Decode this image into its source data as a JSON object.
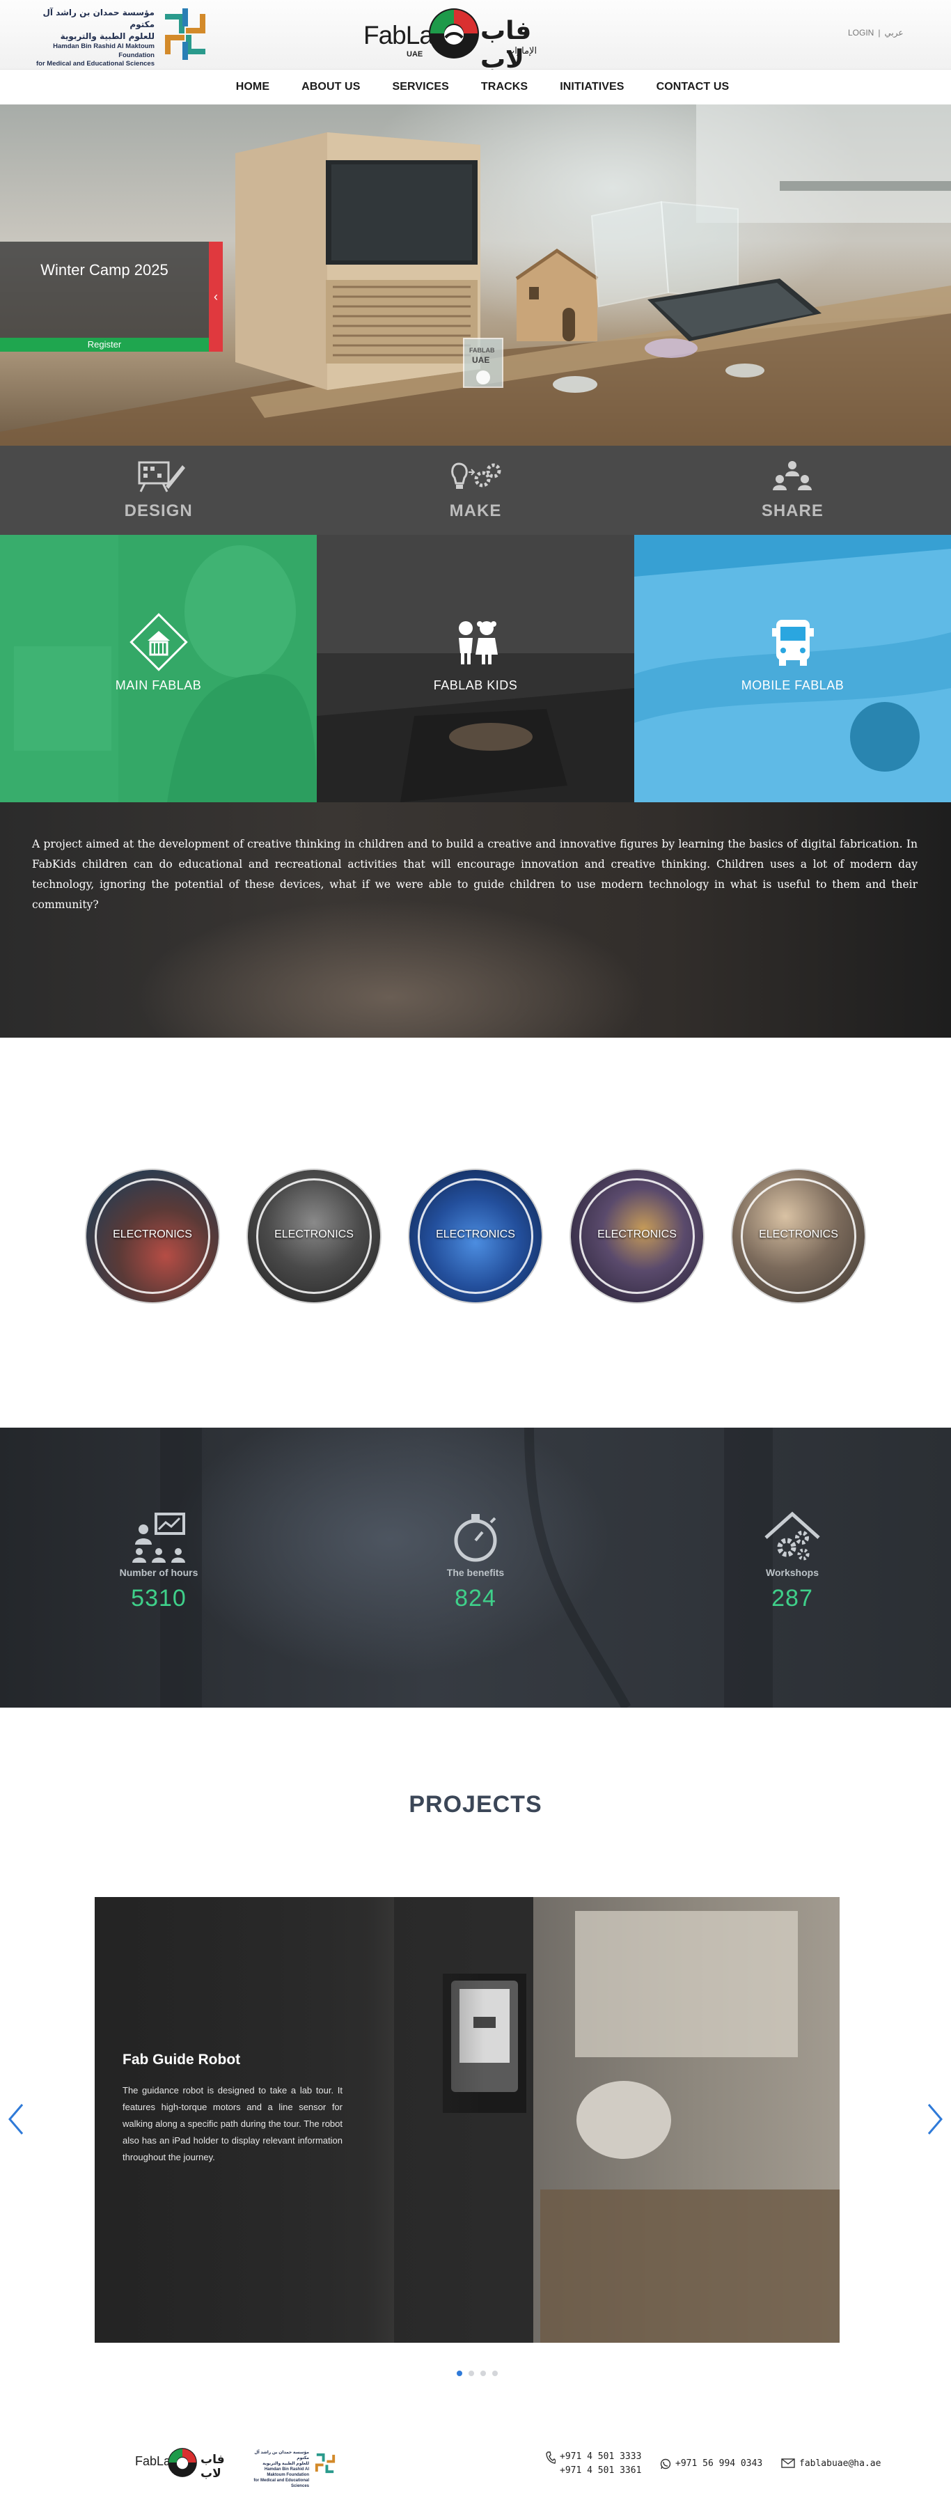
{
  "header": {
    "foundation_ar_line1": "مؤسسة حمدان بن راشد آل مكتوم",
    "foundation_ar_line2": "للعلوم الطبية والتربوية",
    "foundation_en_line1": "Hamdan Bin Rashid Al Maktoum Foundation",
    "foundation_en_line2": "for Medical and Educational Sciences",
    "fablab_en": "FabLab",
    "fablab_uae": "UAE",
    "fablab_ar": "فاب لاب",
    "fablab_ar_sub": "الإمارات",
    "login_label": "LOGIN",
    "separator": "|",
    "arabic_label": "عربي"
  },
  "nav": {
    "items": [
      "HOME",
      "ABOUT US",
      "SERVICES",
      "TRACKS",
      "INITIATIVES",
      "CONTACT US"
    ]
  },
  "hero": {
    "slide_title": "Winter Camp 2025",
    "register_label": "Register",
    "toggle_glyph": "‹",
    "sign_line1": "FABLAB",
    "sign_line2": "UAE"
  },
  "steps": [
    "DESIGN",
    "MAKE",
    "SHARE"
  ],
  "tiles": [
    "MAIN FABLAB",
    "FABLAB KIDS",
    "MOBILE FABLAB"
  ],
  "about": {
    "text": "A project aimed at the development of creative thinking in children and to build a creative and innovative figures by learning the basics of digital fabrication. In FabKids children can do educational and recreational activities that will encourage innovation and creative thinking. Children uses a lot of modern day technology, ignoring the potential of these devices, what if we were able to guide children to use modern technology in what is useful to them and their community?"
  },
  "circles": [
    "ELECTRONICS",
    "ELECTRONICS",
    "ELECTRONICS",
    "ELECTRONICS",
    "ELECTRONICS"
  ],
  "stats": [
    {
      "label": "Number of hours",
      "value": "5310",
      "icon": "presentation-icon"
    },
    {
      "label": "The benefits",
      "value": "824",
      "icon": "stopwatch-icon"
    },
    {
      "label": "Workshops",
      "value": "287",
      "icon": "gears-house-icon"
    }
  ],
  "projects": {
    "title": "PROJECTS",
    "slide_title": "Fab Guide Robot",
    "slide_text": "The guidance robot is designed to take a lab tour. It features high-torque motors and a line sensor for walking along a specific path during the tour. The robot also has an iPad holder to display relevant information throughout the journey.",
    "prev_icon": "chevron-left-icon",
    "next_icon": "chevron-right-icon",
    "dot_count": 4,
    "active_dot": 1
  },
  "footer": {
    "phone_1": "+971 4 501 3333",
    "phone_2": "+971 4 501 3361",
    "whatsapp": "+971 56 994 0343",
    "email": "fablabuae@ha.ae"
  },
  "colors": {
    "green_accent": "#3fd08a",
    "register_green": "#1fa64f",
    "hero_red": "#e0393e",
    "tile_green": "#29b96a",
    "tile_blue": "#2aa6e0",
    "arrow_blue": "#2f7ad8"
  }
}
